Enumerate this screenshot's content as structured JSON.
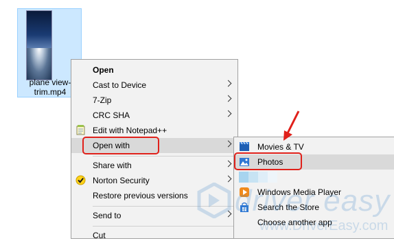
{
  "desktop_file": {
    "name_line1": "plane view-",
    "name_line2": "trim.mp4"
  },
  "context_menu": {
    "items": [
      {
        "label": "Open",
        "bold": true
      },
      {
        "label": "Cast to Device"
      },
      {
        "label": "7-Zip"
      },
      {
        "label": "CRC SHA"
      },
      {
        "label": "Edit with Notepad++"
      },
      {
        "label": "Open with"
      },
      {
        "label": "Share with"
      },
      {
        "label": "Norton Security"
      },
      {
        "label": "Restore previous versions"
      },
      {
        "label": "Send to"
      },
      {
        "label": "Cut"
      }
    ]
  },
  "open_with_submenu": {
    "items": [
      {
        "label": "Movies & TV"
      },
      {
        "label": "Photos"
      },
      {
        "label": ""
      },
      {
        "label": "Windows Media Player"
      },
      {
        "label": "Search the Store"
      },
      {
        "label": "Choose another app"
      }
    ]
  },
  "watermark": {
    "text": "driver easy",
    "url": "www.DriverEasy.com"
  },
  "colors": {
    "highlight_red": "#e0201a",
    "selection": "#cce8ff",
    "menu_bg": "#f2f2f2"
  }
}
